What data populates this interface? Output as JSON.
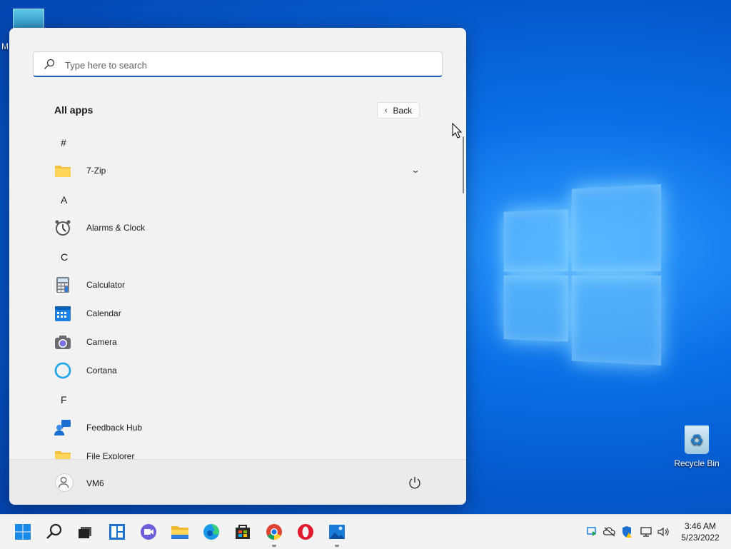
{
  "desktop": {
    "top_icon_letter": "M",
    "recycle_bin_label": "Recycle Bin"
  },
  "start_menu": {
    "search": {
      "placeholder": "Type here to search",
      "value": ""
    },
    "heading": "All apps",
    "back_label": "Back",
    "apps": [
      {
        "letter": "#",
        "name": "7-Zip",
        "icon": "folder-icon",
        "expandable": true
      },
      {
        "letter": "A",
        "name": "Alarms & Clock",
        "icon": "alarm-clock-icon"
      },
      {
        "letter": "C",
        "name": "Calculator",
        "icon": "calculator-icon"
      },
      {
        "name": "Calendar",
        "icon": "calendar-icon"
      },
      {
        "name": "Camera",
        "icon": "camera-icon"
      },
      {
        "name": "Cortana",
        "icon": "cortana-icon"
      },
      {
        "letter": "F",
        "name": "Feedback Hub",
        "icon": "feedback-hub-icon"
      },
      {
        "name": "File Explorer",
        "icon": "folder-icon"
      }
    ],
    "user_name": "VM6"
  },
  "taskbar": {
    "icons": [
      "start-icon",
      "search-icon",
      "task-view-icon",
      "widgets-icon",
      "teams-chat-icon",
      "file-explorer-icon",
      "edge-icon",
      "store-icon",
      "chrome-icon",
      "opera-icon",
      "photos-icon"
    ],
    "clock_time": "3:46 AM",
    "clock_date": "5/23/2022"
  },
  "colors": {
    "accent": "#1a5fb4",
    "wallpaper": "#0a6fe6"
  }
}
